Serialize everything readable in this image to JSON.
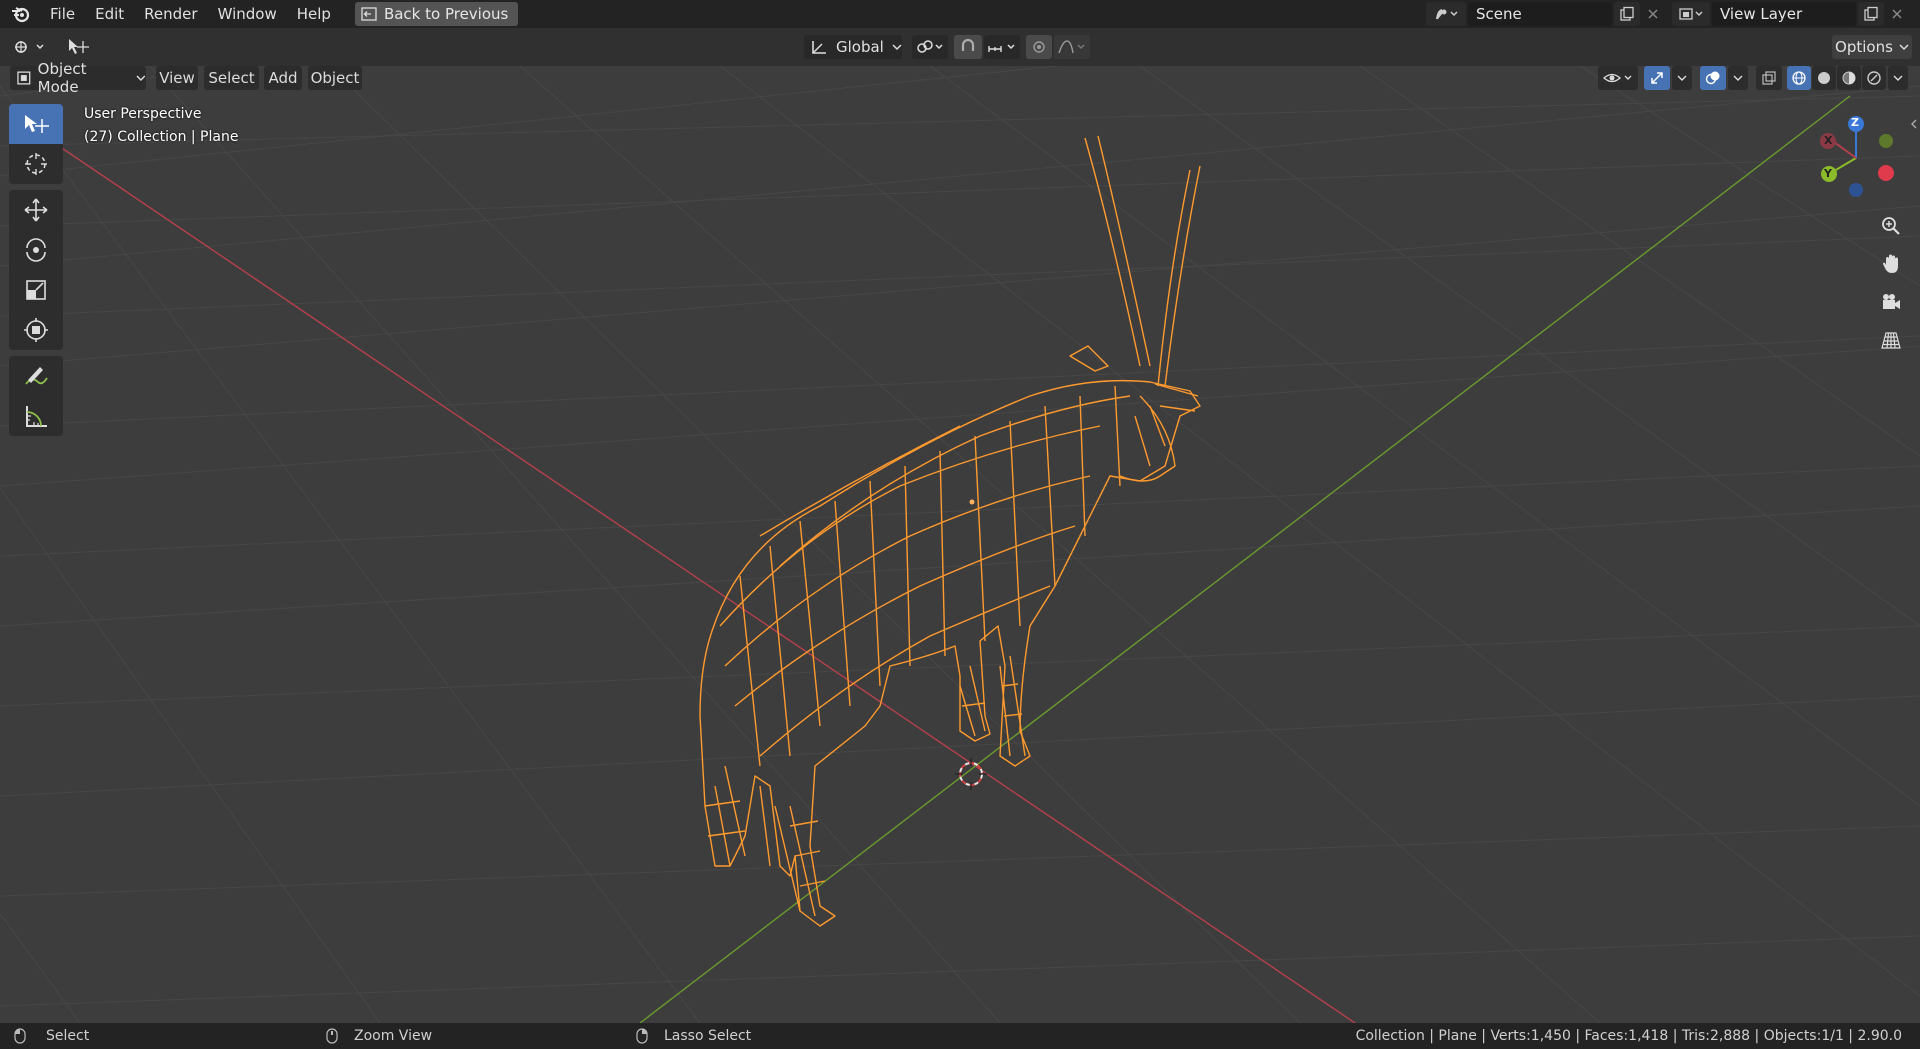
{
  "menu": {
    "items": [
      "File",
      "Edit",
      "Render",
      "Window",
      "Help"
    ],
    "back_button": "Back to Previous"
  },
  "scene": {
    "name": "Scene",
    "view_layer": "View Layer"
  },
  "tool_header": {
    "orientation": "Global",
    "options": "Options"
  },
  "viewport_header": {
    "mode": "Object Mode",
    "menus": [
      "View",
      "Select",
      "Add",
      "Object"
    ]
  },
  "overlay": {
    "perspective": "User Perspective",
    "collection": "(27) Collection | Plane"
  },
  "gizmo": {
    "x": "X",
    "y": "Y",
    "z": "Z"
  },
  "statusbar": {
    "left": "Select",
    "middle": "Zoom View",
    "right_action": "Lasso Select",
    "stats": "Collection | Plane | Verts:1,450 | Faces:1,418 | Tris:2,888 | Objects:1/1 | 2.90.0"
  },
  "colors": {
    "accent": "#4772b3",
    "selection": "#ff9a2f",
    "x_axis": "#b5404d",
    "y_axis": "#6a9a2e"
  }
}
